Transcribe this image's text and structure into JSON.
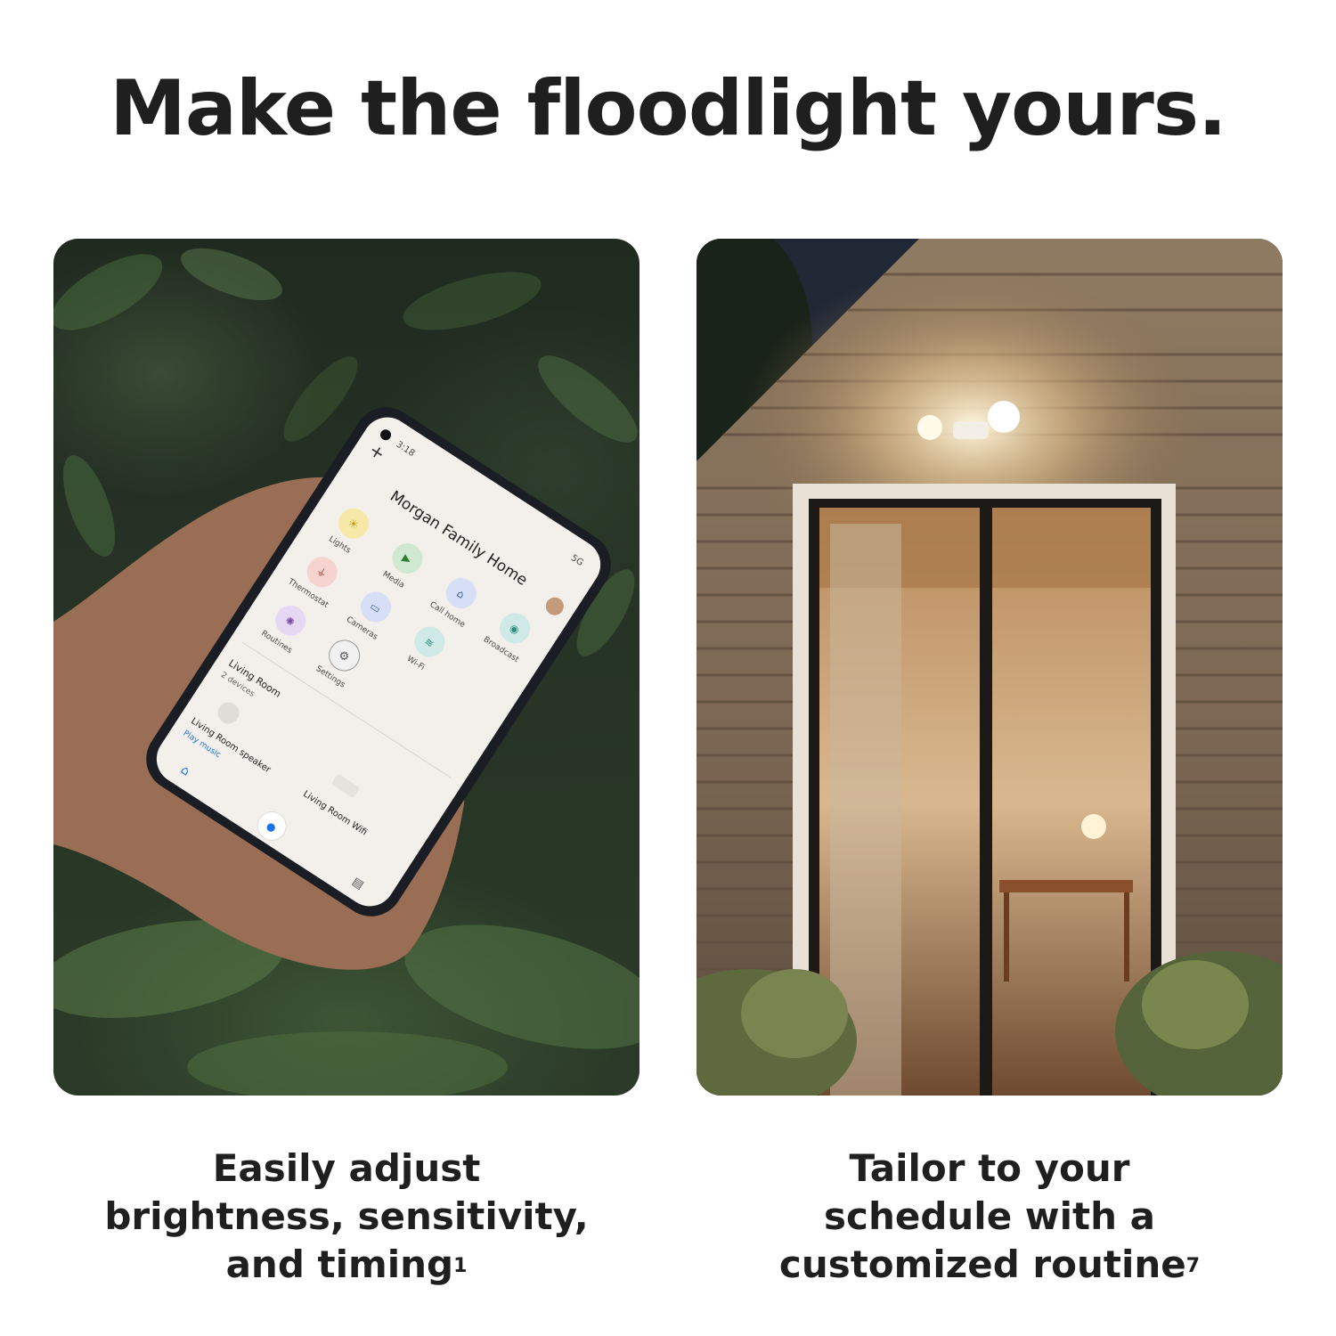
{
  "headline": "Make the floodlight yours.",
  "phone": {
    "time": "3:18",
    "network": "5G",
    "home_title": "Morgan Family Home",
    "shortcuts": [
      {
        "label": "Lights",
        "icon": "bulb-icon",
        "color": "#f6e9a8"
      },
      {
        "label": "Media",
        "icon": "media-icon",
        "color": "#cfe8cf"
      },
      {
        "label": "Call home",
        "icon": "call-home-icon",
        "color": "#d6dff5"
      },
      {
        "label": "Broadcast",
        "icon": "broadcast-icon",
        "color": "#cfeae6"
      },
      {
        "label": "Thermostat",
        "icon": "thermometer-icon",
        "color": "#f6d3cf"
      },
      {
        "label": "Cameras",
        "icon": "camera-icon",
        "color": "#d6dff5"
      },
      {
        "label": "Wi-Fi",
        "icon": "wifi-icon",
        "color": "#cfeae6"
      },
      {
        "label": "Routines",
        "icon": "routines-icon",
        "color": "#e6d8f2"
      },
      {
        "label": "Settings",
        "icon": "settings-icon",
        "color": "#f1f1f1"
      }
    ],
    "room": {
      "name": "Living Room",
      "devices": "2 devices"
    },
    "devices": [
      {
        "name": "Living Room speaker",
        "action": "Play music"
      },
      {
        "name": "Living Room Wifi"
      }
    ]
  },
  "captions": {
    "left": {
      "line1": "Easily adjust",
      "line2": "brightness, sensitivity,",
      "line3": "and timing",
      "footnote": "1"
    },
    "right": {
      "line1": "Tailor to your",
      "line2": "schedule with a",
      "line3": "customized routine",
      "footnote": "7"
    }
  }
}
